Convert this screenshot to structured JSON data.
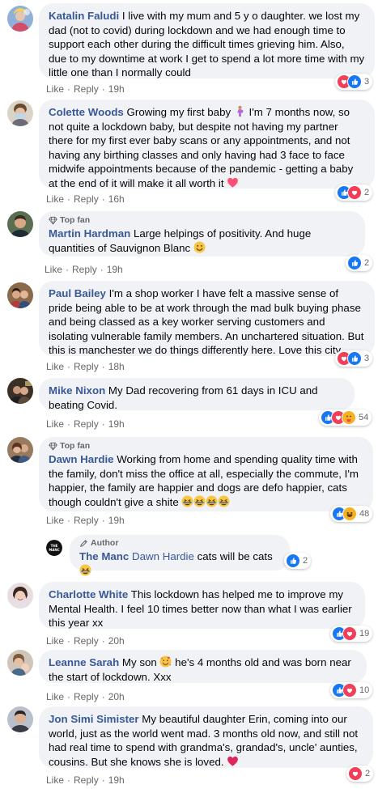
{
  "comments": [
    {
      "author": "Katalin Faludi",
      "text": "I live with my mum and 5 y o daughter. we lost my dad (not to covid) during lockdown and we had enough time to support each other during the difficult times grieving him. Also, due to my downtime at work I get to spend a lot more time with my little one than I normally could",
      "badge": "",
      "like": "Like",
      "reply": "Reply",
      "time": "19h",
      "reactions": [
        "love",
        "like"
      ],
      "count": "3"
    },
    {
      "author": "Colette Woods",
      "text": "Growing my first baby",
      "text2": "I'm 7 months now, so not quite a lockdown baby, but despite not having my partner there for my first ever baby scans or any appointments, and not having any birthing classes and only having had 3 face to face midwife appointments because of the pandemic - getting a baby at the end of it will make it all worth it",
      "like": "Like",
      "reply": "Reply",
      "time": "16h",
      "reactions": [
        "like",
        "love"
      ],
      "count": "2"
    },
    {
      "author": "Martin Hardman",
      "text": "Large helpings of positivity. And huge quantities of Sauvignon Blanc",
      "badge": "Top fan",
      "like": "Like",
      "reply": "Reply",
      "time": "19h",
      "reactions": [
        "like"
      ],
      "count": "2"
    },
    {
      "author": "Paul Bailey",
      "text": "I'm a shop worker I have felt a massive sense of pride being able to be at work through the mad bulk buying phase and being classed as a key worker serving customers and isolating vulnerable family members. An unchartered situation. But this is manchester we do things differently here. Love this city.",
      "like": "Like",
      "reply": "Reply",
      "time": "18h",
      "reactions": [
        "love",
        "like"
      ],
      "count": "3"
    },
    {
      "author": "Mike Nixon",
      "text": "My Dad recovering from 61 days in ICU and beating Covid.",
      "like": "Like",
      "reply": "Reply",
      "time": "19h",
      "reactions": [
        "like",
        "love",
        "care"
      ],
      "count": "54"
    },
    {
      "author": "Dawn Hardie",
      "text": "Working from home and spending quality time with the family, don't miss the office at all, especially the commute, I'm happier, the family are happier and dogs are defo happier, cats though couldn't give a shite",
      "badge": "Top fan",
      "like": "Like",
      "reply": "Reply",
      "time": "19h",
      "reactions": [
        "like",
        "haha"
      ],
      "count": "48"
    },
    {
      "author": "Charlotte White",
      "text": "This lockdown has helped me to improve my Mental Health. I feel 10 times better now than what I was earlier this year xx",
      "like": "Like",
      "reply": "Reply",
      "time": "20h",
      "reactions": [
        "like",
        "love"
      ],
      "count": "19"
    },
    {
      "author": "Leanne Sarah",
      "text": "My son",
      "text2": "he's 4 months old and was born near the start of lockdown. Xxx",
      "like": "Like",
      "reply": "Reply",
      "time": "20h",
      "reactions": [
        "like",
        "love"
      ],
      "count": "10"
    },
    {
      "author": "Jon Simi Simister",
      "text": "My beautiful daughter Erin, coming into our world, just as the world went mad. 3 months old now, and still not had real time to spend with grandma's, grandad's, uncle' aunties, cousins. But she knows she is loved.",
      "like": "Like",
      "reply": "Reply",
      "time": "19h",
      "reactions": [
        "love"
      ],
      "count": "2"
    }
  ],
  "reply": {
    "badge": "Author",
    "author": "The Manc",
    "mention": "Dawn Hardie",
    "text": "cats will be cats",
    "reactions": [
      "like"
    ],
    "count": "2",
    "logo_text": "THE MANC"
  },
  "colors": {
    "author": "#385898",
    "bubble": "#f0f2f5",
    "meta": "#65676b",
    "like": "#1877f2",
    "love": "#f33e58",
    "haha": "#f7b125"
  }
}
